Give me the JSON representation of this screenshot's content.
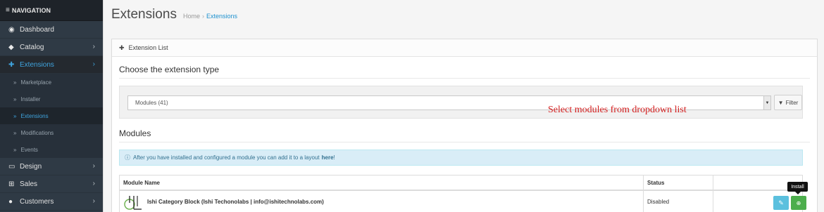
{
  "nav": {
    "header": "NAVIGATION",
    "items": [
      {
        "label": "Dashboard",
        "icon": "dashboard-icon"
      },
      {
        "label": "Catalog",
        "icon": "tag-icon"
      },
      {
        "label": "Extensions",
        "icon": "puzzle-icon"
      },
      {
        "label": "Design",
        "icon": "monitor-icon"
      },
      {
        "label": "Sales",
        "icon": "cart-icon"
      },
      {
        "label": "Customers",
        "icon": "user-icon"
      }
    ],
    "sub_items": [
      {
        "label": "Marketplace"
      },
      {
        "label": "Installer"
      },
      {
        "label": "Extensions"
      },
      {
        "label": "Modifications"
      },
      {
        "label": "Events"
      }
    ]
  },
  "header": {
    "title": "Extensions",
    "breadcrumb_home": "Home",
    "breadcrumb_current": "Extensions"
  },
  "panel": {
    "heading": "Extension List",
    "choose_title": "Choose the extension type",
    "select_value": "Modules (41)",
    "filter_label": "Filter",
    "modules_title": "Modules",
    "alert_text": "After you have installed and configured a module you can add it to a layout",
    "alert_link": "here",
    "alert_end": "!"
  },
  "annotation": "Select modules from dropdown list",
  "table": {
    "col_name": "Module Name",
    "col_status": "Status",
    "rows": [
      {
        "name": "Ishi Category Block (Ishi Techonolabs | info@ishitechnolabs.com)",
        "status": "Disabled"
      }
    ]
  },
  "tooltip": "Install",
  "colors": {
    "sidebar_bg": "#2f3a45",
    "active_link": "#3fa4de",
    "install_btn": "#4cae4c",
    "edit_btn": "#5bc0de",
    "annotation": "#d32020"
  }
}
